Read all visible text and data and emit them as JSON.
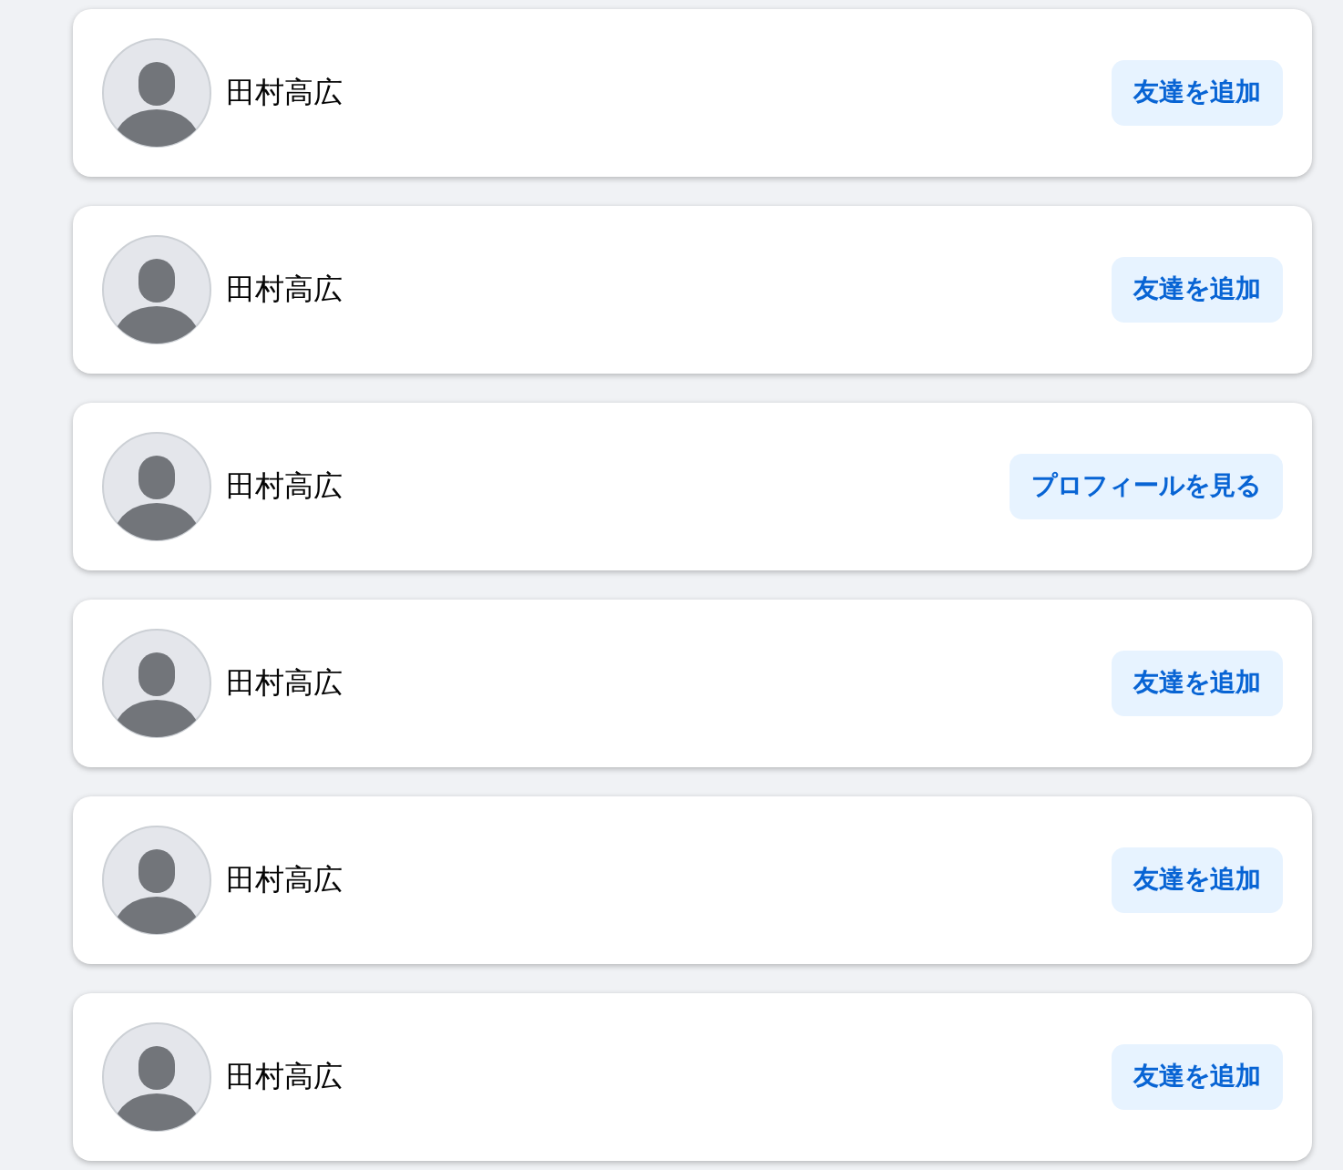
{
  "people": [
    {
      "name": "田村高広",
      "action": "友達を追加"
    },
    {
      "name": "田村高広",
      "action": "友達を追加"
    },
    {
      "name": "田村高広",
      "action": "プロフィールを見る"
    },
    {
      "name": "田村高広",
      "action": "友達を追加"
    },
    {
      "name": "田村高広",
      "action": "友達を追加"
    },
    {
      "name": "田村高広",
      "action": "友達を追加"
    }
  ]
}
